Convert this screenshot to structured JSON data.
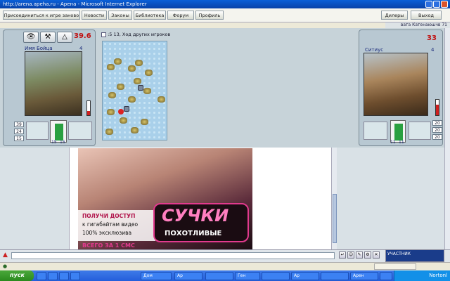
{
  "window": {
    "title": "http://arena.apeha.ru - Арена - Microsoft Internet Explorer"
  },
  "nav": {
    "items": [
      "Присоединиться к игре заново",
      "Новости",
      "Законы",
      "Библиотека",
      "Форум",
      "Профиль"
    ],
    "right_items": [
      "Дилеры",
      "Выход"
    ],
    "user_line": "вата Катенаюшчв 71"
  },
  "left_player": {
    "name": "Имя Бойца",
    "level": "4",
    "score": "39.6",
    "stats": [
      "39",
      "24",
      "15"
    ],
    "bottom_nums": [
      "15",
      "15"
    ]
  },
  "board": {
    "header": ":5 13, Ход других игроков"
  },
  "right_player": {
    "name": "Ситиус",
    "level": "4",
    "score": "33",
    "stats": [
      "20",
      "20",
      "20"
    ],
    "bottom_nums": [
      "11",
      "11"
    ]
  },
  "ad": {
    "line1": "ПОЛУЧИ ДОСТУП",
    "line2": "к гигабайтам видео",
    "line3": "100% эксклюзива",
    "logo_main": "СУЧКИ",
    "logo_sub": "ПОХОТЛИВЫЕ",
    "bottom": "ВСЕГО ЗА 1 СМС"
  },
  "chat": {
    "placeholder": ""
  },
  "footer_badge": "УЧАСТНИК",
  "taskbar": {
    "start": "пуск",
    "tasks": [
      "",
      "",
      "",
      "",
      "Дом",
      "Ар",
      "",
      "Ген",
      "",
      "Ар",
      "",
      "Арен",
      "",
      ""
    ],
    "tray_time": "Nortonl"
  }
}
